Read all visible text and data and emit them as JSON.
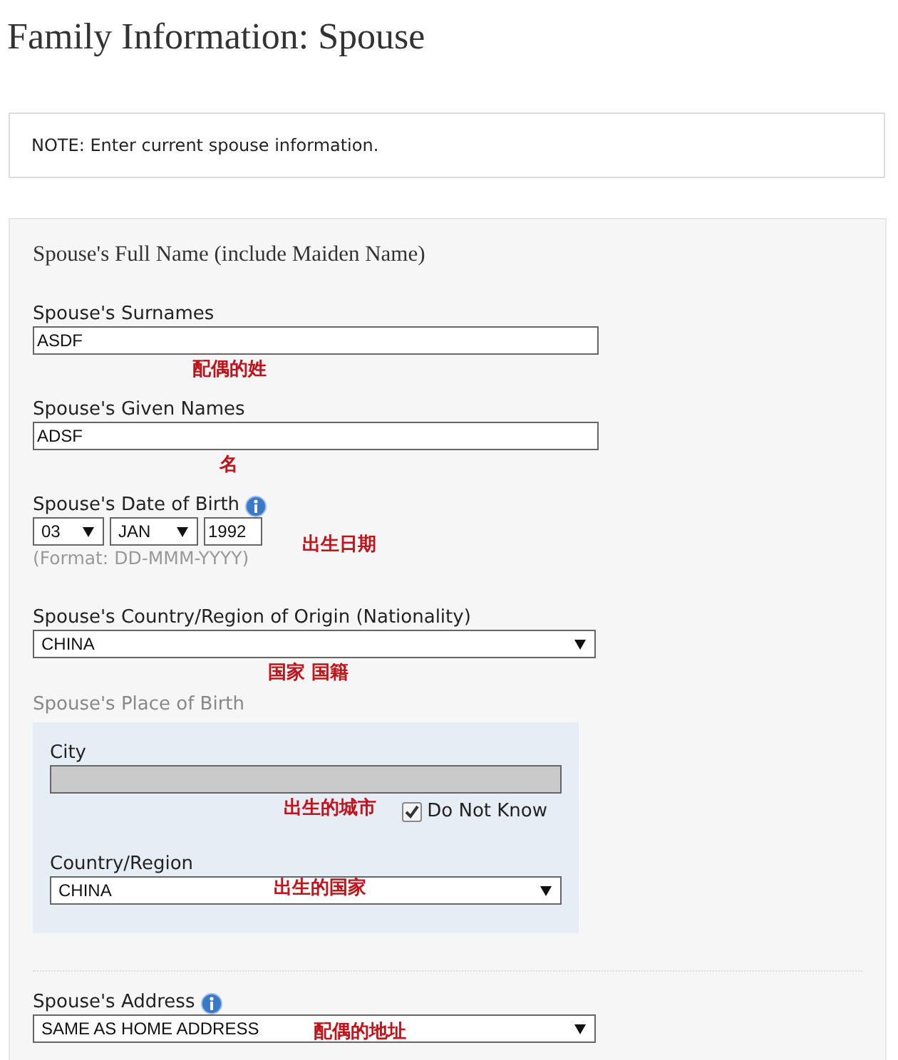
{
  "title": "Family Information: Spouse",
  "note": "NOTE: Enter current spouse information.",
  "section_heading": "Spouse's Full Name (include Maiden Name)",
  "surnames": {
    "label": "Spouse's Surnames",
    "value": "ASDF",
    "annotation": "配偶的姓"
  },
  "given_names": {
    "label": "Spouse's Given Names",
    "value": "ADSF",
    "annotation": "名"
  },
  "date_of_birth": {
    "label": "Spouse's Date of Birth",
    "day": "03",
    "month": "JAN",
    "year": "1992",
    "format": "(Format: DD-MMM-YYYY)",
    "annotation": "出生日期"
  },
  "nationality": {
    "label": "Spouse's Country/Region of Origin (Nationality)",
    "value": "CHINA",
    "annotation": "国家 国籍"
  },
  "place_of_birth": {
    "label": "Spouse's Place of Birth",
    "city_label": "City",
    "city_disabled": true,
    "city_annotation": "出生的城市",
    "do_not_know": {
      "label": "Do Not Know",
      "checked": true
    },
    "country_label": "Country/Region",
    "country": "CHINA",
    "country_annotation": "出生的国家"
  },
  "address": {
    "label": "Spouse's Address",
    "value": "SAME AS HOME ADDRESS",
    "annotation": "配偶的地址"
  }
}
